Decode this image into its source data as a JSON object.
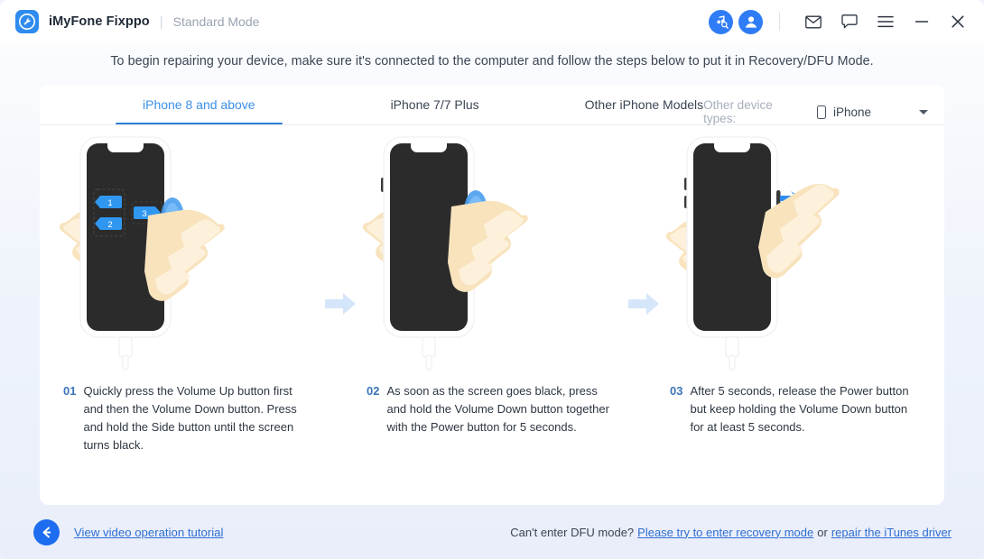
{
  "titlebar": {
    "logo_icon": "wrench-circle-logo",
    "app_name": "iMyFone Fixppo",
    "separator": "|",
    "mode": "Standard Mode",
    "actions": [
      {
        "name": "music-search-icon",
        "label": "itunes-search"
      },
      {
        "name": "user-avatar-icon",
        "label": "account"
      },
      {
        "name": "mail-icon",
        "label": "mail"
      },
      {
        "name": "chat-icon",
        "label": "feedback"
      },
      {
        "name": "menu-icon",
        "label": "menu"
      },
      {
        "name": "minimize-icon",
        "label": "minimize"
      },
      {
        "name": "close-icon",
        "label": "close"
      }
    ]
  },
  "instruction": "To begin repairing your device, make sure it's connected to the computer and follow the steps below to put it in Recovery/DFU Mode.",
  "tabs": [
    {
      "label": "iPhone 8 and above",
      "active": true
    },
    {
      "label": "iPhone 7/7 Plus",
      "active": false
    },
    {
      "label": "Other iPhone Models",
      "active": false
    }
  ],
  "device_select": {
    "label": "Other device types:",
    "icon": "phone-icon",
    "value": "iPhone",
    "caret": "chevron-down-icon"
  },
  "steps": [
    {
      "number": "01",
      "text": "Quickly press the Volume Up button first and then the Volume Down button. Press and hold the Side button until the screen turns black.",
      "badges": [
        "1",
        "2",
        "3"
      ]
    },
    {
      "number": "02",
      "text": "As soon as the screen goes black, press and hold the Volume Down button together with the Power button for 5 seconds.",
      "badges": []
    },
    {
      "number": "03",
      "text": "After 5 seconds, release the Power button but keep holding the Volume Down button for at least 5 seconds.",
      "badges": []
    }
  ],
  "footer": {
    "back_icon": "arrow-left-icon",
    "tutorial_link": "View video operation tutorial",
    "help_prefix": "Can't enter DFU mode?",
    "help_link_1": "Please try to enter recovery mode",
    "help_conjunction": "or",
    "help_link_2": "repair the iTunes driver"
  },
  "colors": {
    "accent_blue": "#2f7cf6",
    "link_blue": "#2f6fd0",
    "tab_active": "#3b8fe8",
    "panel_bg": "#ffffff",
    "window_bg": "#eef3fb",
    "phone_screen": "#2b2b2b",
    "hand_skin": "#f6d9ae",
    "button_blue": "#4a9ef0"
  }
}
